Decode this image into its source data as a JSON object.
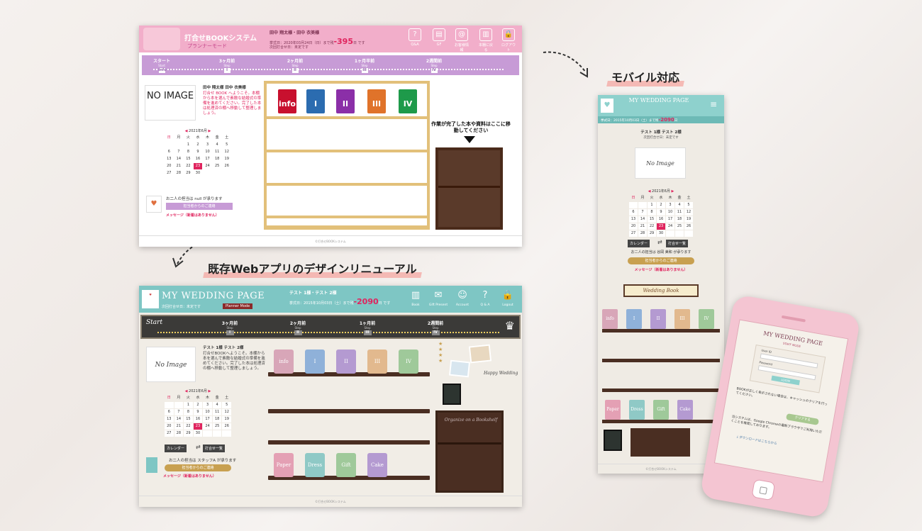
{
  "captions": {
    "renewal": "既存Webアプリのデザインリニューアル",
    "mobile": "モバイル対応"
  },
  "old_screen": {
    "title": "打合せBOOKシステム",
    "mode": "プランナーモード",
    "user": "田中 翔太様・田中 衣美様",
    "deadline_prefix": "挙式日：2020年03月24日（日）まで残",
    "days_left": "-395",
    "deadline_suffix": "日 です",
    "next_meeting": "次回打合せ日：未定です",
    "nav": [
      {
        "icon": "?",
        "label": "Q&A"
      },
      {
        "icon": "▤",
        "label": "GF"
      },
      {
        "icon": "@",
        "label": "お客様情報"
      },
      {
        "icon": "▥",
        "label": "本棚に戻る"
      },
      {
        "icon": "🔒",
        "label": "ログアウト"
      }
    ],
    "steps": [
      {
        "label": "スタート",
        "sub": "Start",
        "box": "Info"
      },
      {
        "label": "3ヶ月前",
        "sub": "Step",
        "box": "I"
      },
      {
        "label": "2ヶ月前",
        "sub": "Step",
        "box": "II"
      },
      {
        "label": "1ヶ月半前",
        "sub": "Step",
        "box": "III"
      },
      {
        "label": "2週間前",
        "sub": "Step",
        "box": "IV"
      }
    ],
    "no_image": "NO IMAGE",
    "names": "田中 翔太様 田中 衣美様",
    "welcome": "打合せ BOOK へようこそ。本棚から本を選んで素敵な結婚式の準備を進めてください。完了した本は処理済の棚へ移動して整理しましょう。",
    "books": [
      {
        "label": "info",
        "color": "#c8102e"
      },
      {
        "label": "I",
        "color": "#2b6cb0"
      },
      {
        "label": "II",
        "color": "#8b2fa8"
      },
      {
        "label": "III",
        "color": "#e0732a"
      },
      {
        "label": "IV",
        "color": "#1e9a4a"
      }
    ],
    "done_caption": "作業が完了した本や資料はここに移動してください",
    "room": "お二人の担当は null が承ります",
    "contact": "担当者からのご連絡",
    "message": "メッセージ（新着はありません）",
    "footer": "©打合せBOOKシステム"
  },
  "calendar": {
    "month": "2021年6月",
    "weekdays": [
      "日",
      "月",
      "火",
      "水",
      "木",
      "金",
      "土"
    ],
    "days": [
      "",
      "",
      "1",
      "2",
      "3",
      "4",
      "5",
      "6",
      "7",
      "8",
      "9",
      "10",
      "11",
      "12",
      "13",
      "14",
      "15",
      "16",
      "17",
      "18",
      "19",
      "20",
      "21",
      "22",
      "23",
      "24",
      "25",
      "26",
      "27",
      "28",
      "29",
      "30",
      "",
      "",
      ""
    ],
    "today": "23"
  },
  "new_screen": {
    "title": "MY WEDDING PAGE",
    "next_meeting": "次回打合せ日：未定です",
    "mode": "Planner Mode",
    "user": "テスト 1様・テスト 2様",
    "deadline_prefix": "挙式日：2015年10月03日（土）まで残",
    "days_left": "-2090",
    "deadline_suffix": "日 です",
    "nav": [
      {
        "icon": "▥",
        "label": "Book"
      },
      {
        "icon": "✉",
        "label": "Gift Present"
      },
      {
        "icon": "☺",
        "label": "Account"
      },
      {
        "icon": "?",
        "label": "Q & A"
      },
      {
        "icon": "🔒",
        "label": "Logout"
      }
    ],
    "start": "Start",
    "steps": [
      {
        "label": "3ヶ月前",
        "sub": "Step",
        "box": "I"
      },
      {
        "label": "2ヶ月前",
        "sub": "Step",
        "box": "II"
      },
      {
        "label": "1ヶ月前",
        "sub": "Step",
        "box": "III"
      },
      {
        "label": "2週間前",
        "sub": "Step",
        "box": "IV"
      }
    ],
    "no_image": "No Image",
    "names": "テスト 1様 テスト 2様",
    "welcome": "打合せBOOKへようこそ。本棚から本を選んで素敵な結婚式の準備を進めてください。完了した本は処理済の棚へ移動して整理しましょう。",
    "books_top": [
      {
        "label": "info",
        "color": "#d8a6b8"
      },
      {
        "label": "I",
        "color": "#8fb1d9"
      },
      {
        "label": "II",
        "color": "#b49ad1"
      },
      {
        "label": "III",
        "color": "#e2b98e"
      },
      {
        "label": "IV",
        "color": "#9fc99a"
      }
    ],
    "books_bottom": [
      {
        "label": "Paper",
        "color": "#e4a0b4"
      },
      {
        "label": "Dress",
        "color": "#8fc9c6"
      },
      {
        "label": "Gift",
        "color": "#9fc99a"
      },
      {
        "label": "Cake",
        "color": "#b49ad1"
      }
    ],
    "calendar_button": "カレンダー",
    "meetings_button": "打合せ一覧",
    "room": "お二人の担当は スタッフA が承ります",
    "contact": "担当者からのご連絡",
    "message": "メッセージ（新着はありません）",
    "bookshelf_text": "Organize on a Bookshelf",
    "footer": "©打合せBOOKシステム"
  },
  "mobile_screen": {
    "title": "MY WEDDING PAGE",
    "deadline_prefix": "挙式日：2015年10月03日（土）まで残",
    "days_left": "-2090",
    "deadline_suffix": "日",
    "names": "テスト 1様 テスト 2様",
    "next_meeting": "次回打合せ日：未定です",
    "no_image": "No Image",
    "calendar_button": "カレンダー",
    "meetings_button": "打合せ一覧",
    "room": "お二人の担当は 谷岡 美和 が承ります",
    "contact": "担当者からのご連絡",
    "message": "メッセージ（新着はありません）",
    "wedding_book": "Wedding Book",
    "books_top": [
      {
        "label": "info",
        "color": "#d8a6b8"
      },
      {
        "label": "I",
        "color": "#8fb1d9"
      },
      {
        "label": "II",
        "color": "#b49ad1"
      },
      {
        "label": "III",
        "color": "#e2b98e"
      },
      {
        "label": "IV",
        "color": "#9fc99a"
      }
    ],
    "books_bottom": [
      {
        "label": "Paper",
        "color": "#e4a0b4"
      },
      {
        "label": "Dress",
        "color": "#8fc9c6"
      },
      {
        "label": "Gift",
        "color": "#9fc99a"
      },
      {
        "label": "Cake",
        "color": "#b49ad1"
      }
    ],
    "footer": "©打合せBOOKシステム"
  },
  "phone_screen": {
    "title": "MY WEDDING PAGE",
    "staff_mode": "STAFF MODE",
    "user_id_label": "User ID",
    "password_label": "Password",
    "login_button": "LOGIN",
    "note": "BOOKが正しく表示されない場合は、キャッシュのクリアを行ってください。",
    "clear_button": "クリアする",
    "note2": "当システムは、Google Chromeの最新ブラウザでご利用いただくことを推奨しております。",
    "download": "ダウンロードはこちらから"
  },
  "colors": {
    "pink": "#f2aeca",
    "teal": "#7ec6c4",
    "accent": "#e0245e"
  }
}
